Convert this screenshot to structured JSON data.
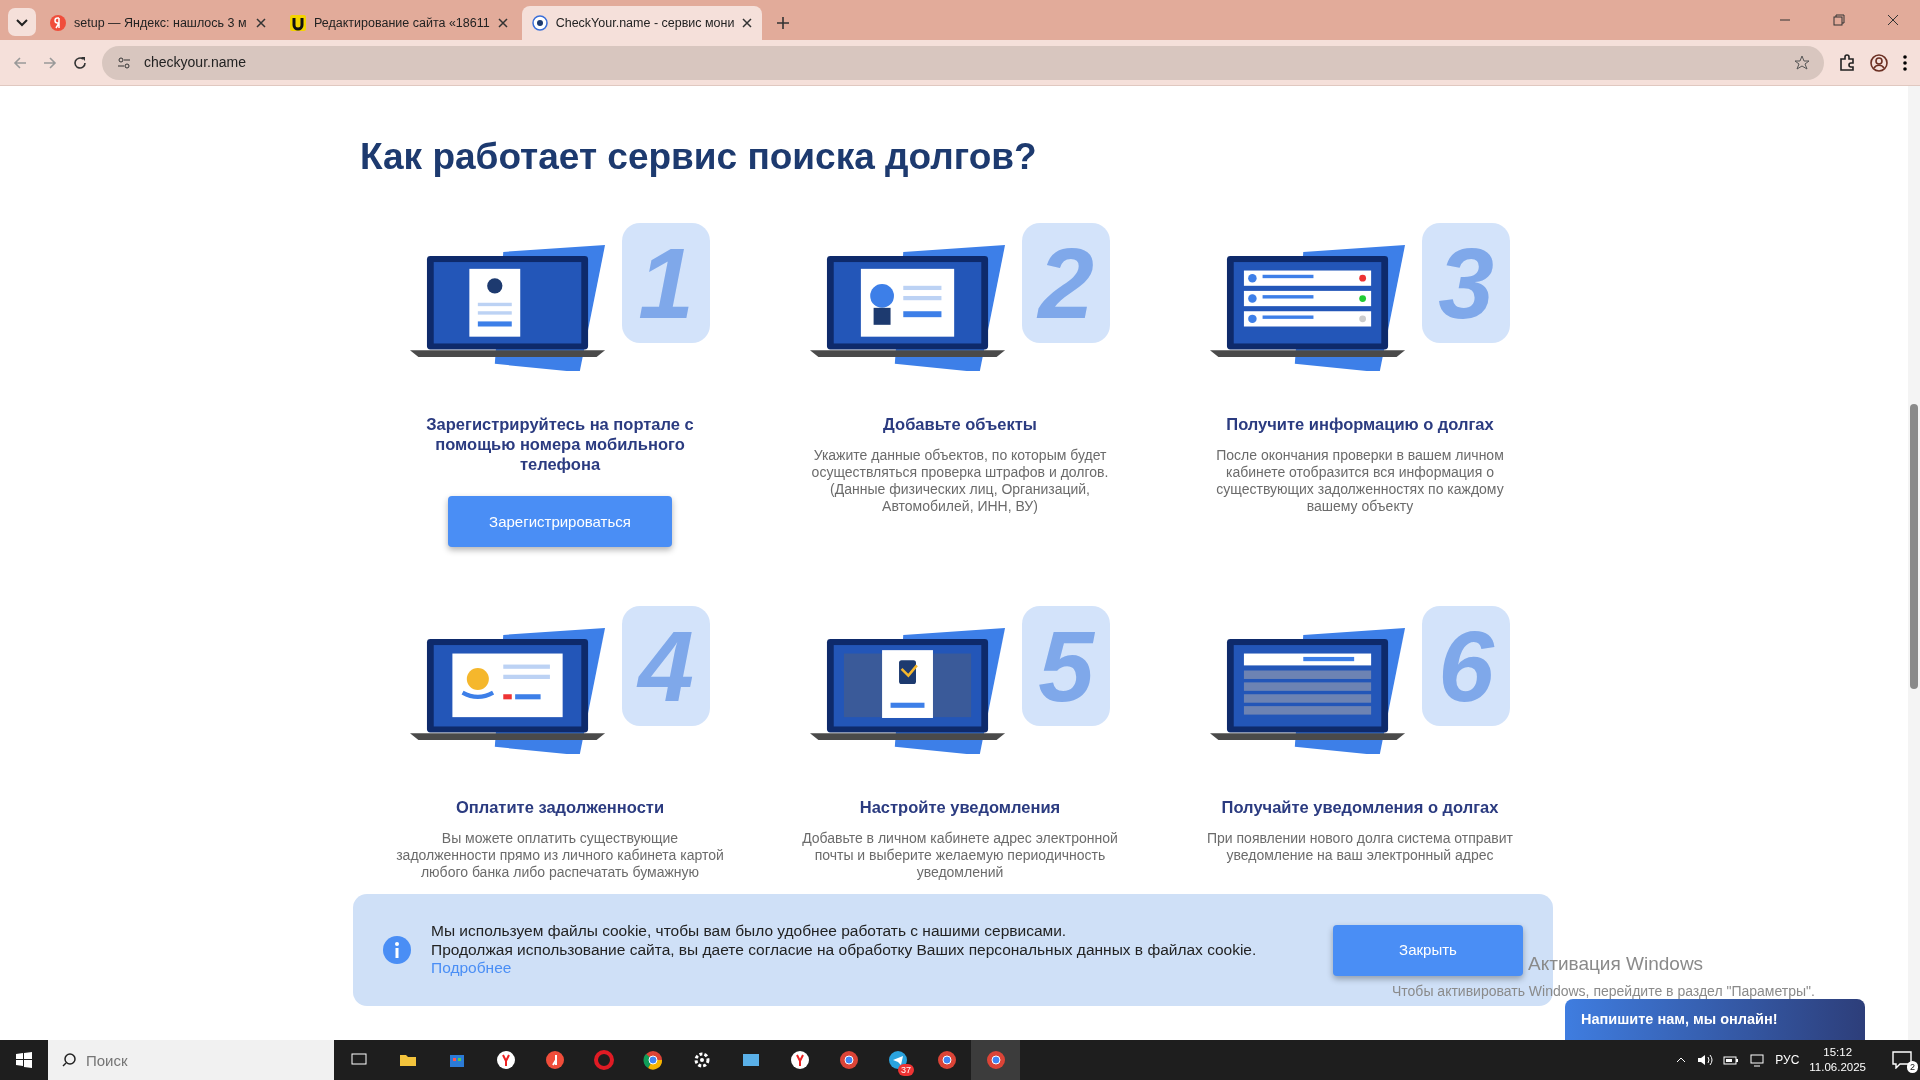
{
  "browser": {
    "tabs": [
      {
        "title": "setup — Яндекс: нашлось 3 м",
        "selected": false
      },
      {
        "title": "Редактирование сайта «18611",
        "selected": false
      },
      {
        "title": "CheckYour.name - сервис мони",
        "selected": true
      }
    ],
    "address": "checkyour.name"
  },
  "page": {
    "heading": "Как работает сервис поиска долгов?",
    "steps": [
      {
        "number": "1",
        "title": "Зарегистрируйтесь на портале с помощью номера мобильного телефона",
        "button": "Зарегистрироваться"
      },
      {
        "number": "2",
        "title": "Добавьте объекты",
        "description": "Укажите данные объектов, по которым будет осуществляться проверка штрафов и долгов. (Данные физических лиц, Организаций, Автомобилей, ИНН, ВУ)"
      },
      {
        "number": "3",
        "title": "Получите информацию о долгах",
        "description": "После окончания проверки в вашем личном кабинете отобразится вся информация о существующих задолженностях по каждому вашему объекту"
      },
      {
        "number": "4",
        "title": "Оплатите задолженности",
        "description": "Вы можете оплатить существующие задолженности прямо из личного кабинета картой любого банка либо распечатать бумажную"
      },
      {
        "number": "5",
        "title": "Настройте уведомления",
        "description": "Добавьте в личном кабинете адрес электронной почты и выберите желаемую периодичность уведомлений"
      },
      {
        "number": "6",
        "title": "Получайте уведомления о долгах",
        "description": "При появлении нового долга система отправит уведомление на ваш электронный адрес"
      }
    ]
  },
  "cookie_banner": {
    "line_1": "Мы используем файлы cookie, чтобы вам было удобнее работать с нашими сервисами.",
    "line_2": "Продолжая использование сайта, вы даете согласие на обработку Ваших персональных данных в файлах cookie.",
    "link": "Подробнее",
    "button": "Закрыть"
  },
  "chat_button": "Напишите нам, мы онлайн!",
  "os_notice": {
    "title": "Активация Windows",
    "text": "Чтобы активировать Windows, перейдите в раздел \"Параметры\"."
  },
  "taskbar": {
    "search_placeholder": "Поиск",
    "telegram_badge": "37",
    "language": "РУС",
    "time": "15:12",
    "date": "11.06.2025",
    "notifications": "2"
  }
}
